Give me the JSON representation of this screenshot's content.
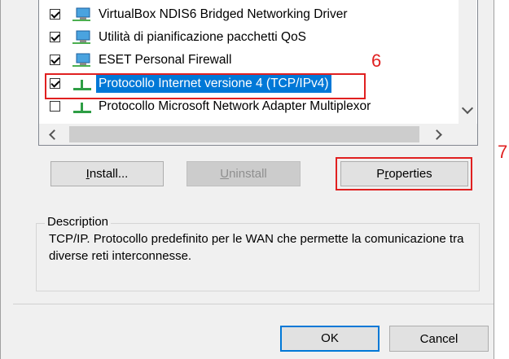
{
  "components": {
    "items": [
      {
        "label": "VirtualBox NDIS6 Bridged Networking Driver",
        "checked": true,
        "icon": "network-client-icon",
        "selected": false
      },
      {
        "label": "Utilità di pianificazione pacchetti QoS",
        "checked": true,
        "icon": "network-client-icon",
        "selected": false
      },
      {
        "label": "ESET Personal Firewall",
        "checked": true,
        "icon": "network-client-icon",
        "selected": false
      },
      {
        "label": "Protocollo Internet versione 4 (TCP/IPv4)",
        "checked": true,
        "icon": "protocol-icon",
        "selected": true
      },
      {
        "label": "Protocollo Microsoft Network Adapter Multiplexor",
        "checked": false,
        "icon": "protocol-icon",
        "selected": false
      }
    ]
  },
  "annotations": {
    "step6": "6",
    "step7": "7",
    "color": "#e02020"
  },
  "buttons": {
    "install_prefix": "",
    "install_underline": "I",
    "install_rest": "nstall...",
    "uninstall_underline": "U",
    "uninstall_rest": "ninstall",
    "properties_prefix": "P",
    "properties_underline": "r",
    "properties_rest": "operties",
    "ok": "OK",
    "cancel": "Cancel"
  },
  "description": {
    "title": "Description",
    "text": "TCP/IP. Protocollo predefinito per le WAN che permette la comunicazione tra diverse reti interconnesse."
  },
  "colors": {
    "selection": "#0078d7",
    "dialog_bg": "#f0f0f0"
  }
}
